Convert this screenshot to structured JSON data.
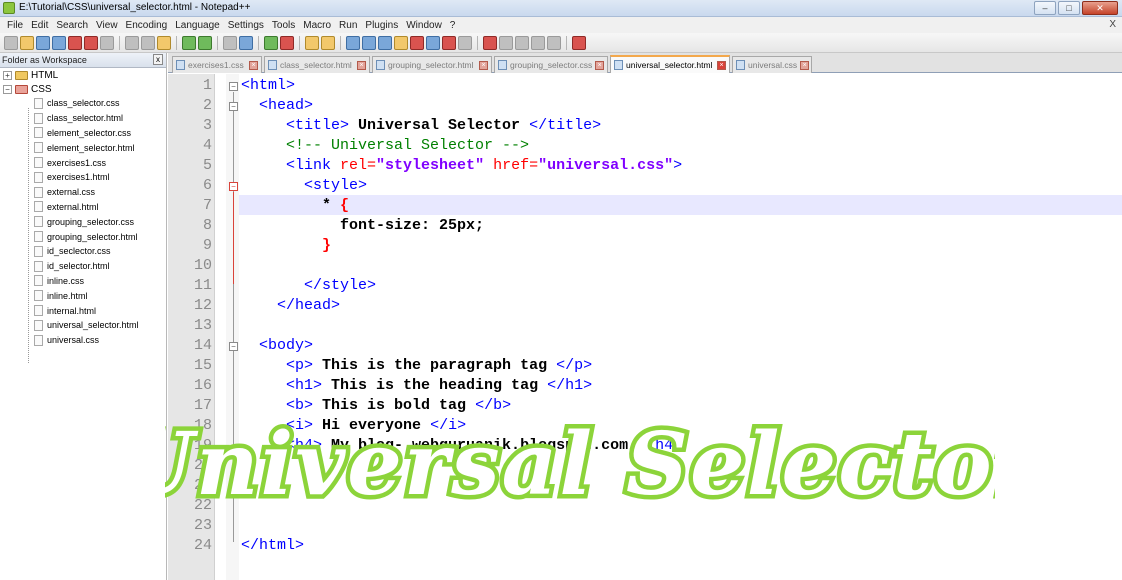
{
  "window": {
    "title": "E:\\Tutorial\\CSS\\universal_selector.html - Notepad++",
    "buttons": [
      "–",
      "□",
      "✕"
    ]
  },
  "menu": [
    "File",
    "Edit",
    "Search",
    "View",
    "Encoding",
    "Language",
    "Settings",
    "Tools",
    "Macro",
    "Run",
    "Plugins",
    "Window",
    "?"
  ],
  "menu_close": "X",
  "sidebar": {
    "header": "Folder as Workspace",
    "header_close": "x",
    "folders": [
      {
        "toggle": "+",
        "label": "HTML"
      },
      {
        "toggle": "−",
        "label": "CSS"
      }
    ],
    "files": [
      "class_selector.css",
      "class_selector.html",
      "element_selector.css",
      "element_selector.html",
      "exercises1.css",
      "exercises1.html",
      "external.css",
      "external.html",
      "grouping_selector.css",
      "grouping_selector.html",
      "id_seclector.css",
      "id_selector.html",
      "inline.css",
      "inline.html",
      "internal.html",
      "universal_selector.html",
      "universal.css"
    ]
  },
  "tabs": [
    {
      "label": "exercises1.css",
      "active": false
    },
    {
      "label": "class_selector.html",
      "active": false
    },
    {
      "label": "grouping_selector.html",
      "active": false
    },
    {
      "label": "grouping_selector.css",
      "active": false
    },
    {
      "label": "universal_selector.html",
      "active": true
    },
    {
      "label": "universal.css",
      "active": false
    }
  ],
  "editor": {
    "line_numbers": [
      "1",
      "2",
      "3",
      "4",
      "5",
      "6",
      "7",
      "8",
      "9",
      "10",
      "11",
      "12",
      "13",
      "14",
      "15",
      "16",
      "17",
      "18",
      "19",
      "20",
      "21",
      "22",
      "23",
      "24"
    ],
    "current_line": 7,
    "lines": {
      "l1": "<html>",
      "l2": "<head>",
      "l3_open": "<title>",
      "l3_text": " Universal Selector ",
      "l3_close": "</title>",
      "l4": "<!-- Universal Selector -->",
      "l5_open": "<link",
      "l5_attr1": " rel=",
      "l5_val1": "\"stylesheet\"",
      "l5_attr2": " href=",
      "l5_val2": "\"universal.css\"",
      "l5_close": ">",
      "l6": "<style>",
      "l7_sel": "*",
      "l7_brace": "{",
      "l8_prop": "font-size: 25px;",
      "l9_brace": "}",
      "l11": "</style>",
      "l12": "</head>",
      "l14": "<body>",
      "l15_open": "<p>",
      "l15_text": " This is the paragraph tag ",
      "l15_close": "</p>",
      "l16_open": "<h1>",
      "l16_text": " This is the heading tag ",
      "l16_close": "</h1>",
      "l17_open": "<b>",
      "l17_text": " This is bold tag ",
      "l17_close": "</b>",
      "l18_open": "<i>",
      "l18_text": " Hi everyone ",
      "l18_close": "</i>",
      "l19_open": "<h4>",
      "l19_text": " My blog- webguruanik.blogspot.com ",
      "l19_close": "</h4>",
      "l24": "</html>"
    }
  },
  "overlay_text": "Universal Selector",
  "colors": {
    "tag": "#0000ff",
    "attribute": "#ff0000",
    "string": "#8000ff",
    "comment": "#008000",
    "current_line": "#e8e8ff",
    "overlay_green": "#8cd43a"
  }
}
